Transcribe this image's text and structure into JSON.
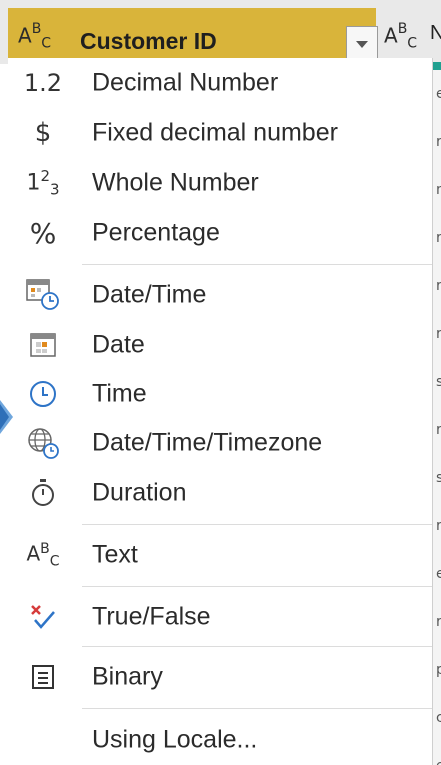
{
  "column_header": {
    "type_icon": "text-type-icon",
    "title": "Customer ID",
    "dropdown_icon": "chevron-down-icon",
    "next_column_type_icon": "text-type-icon",
    "next_column_letter": "N"
  },
  "grid_edge_letters": [
    "e",
    "r",
    "n",
    "r",
    "r",
    "r",
    "s",
    "r",
    "s",
    "r",
    "e",
    "r",
    "p",
    "c",
    "e"
  ],
  "menu": {
    "groups": [
      [
        {
          "icon": "decimal-number-icon",
          "glyph": "1.2",
          "label": "Decimal Number"
        },
        {
          "icon": "dollar-icon",
          "glyph": "$",
          "label": "Fixed decimal number"
        },
        {
          "icon": "whole-number-icon",
          "glyph": "123",
          "label": "Whole Number"
        },
        {
          "icon": "percent-icon",
          "glyph": "%",
          "label": "Percentage"
        }
      ],
      [
        {
          "icon": "datetime-icon",
          "glyph": "",
          "label": "Date/Time"
        },
        {
          "icon": "calendar-icon",
          "glyph": "",
          "label": "Date"
        },
        {
          "icon": "clock-icon",
          "glyph": "",
          "label": "Time"
        },
        {
          "icon": "globe-clock-icon",
          "glyph": "",
          "label": "Date/Time/Timezone"
        },
        {
          "icon": "stopwatch-icon",
          "glyph": "",
          "label": "Duration"
        }
      ],
      [
        {
          "icon": "text-type-icon",
          "glyph": "",
          "label": "Text"
        }
      ],
      [
        {
          "icon": "true-false-icon",
          "glyph": "",
          "label": "True/False"
        }
      ],
      [
        {
          "icon": "binary-icon",
          "glyph": "",
          "label": "Binary"
        }
      ],
      [
        {
          "icon": "",
          "glyph": "",
          "label": "Using Locale..."
        }
      ]
    ]
  },
  "colors": {
    "selected_header": "#d9b43a",
    "accent_blue": "#2e74c7",
    "calendar_orange": "#e08a1e",
    "false_red": "#d63b3b"
  }
}
